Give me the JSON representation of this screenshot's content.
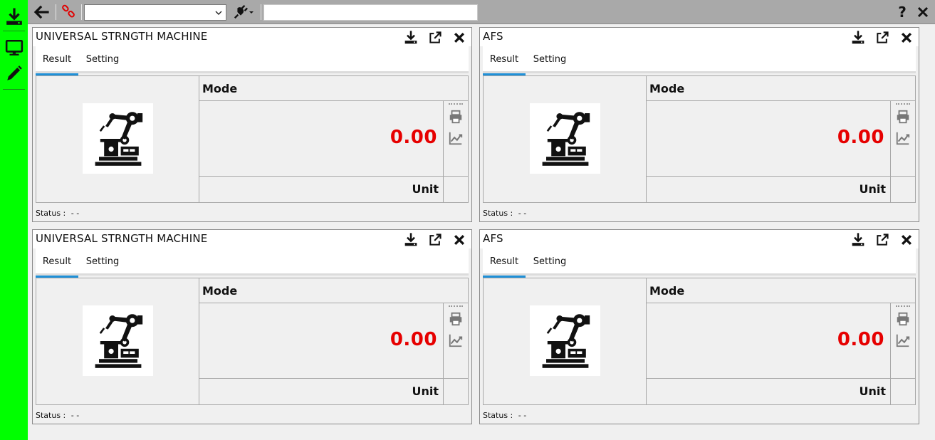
{
  "toolbar": {
    "select_value": "",
    "input_value": "",
    "help_label": "?"
  },
  "panels": [
    {
      "title": "UNIVERSAL STRNGTH MACHINE",
      "tabs": [
        "Result",
        "Setting"
      ],
      "mode_label": "Mode",
      "value": "0.00",
      "unit": "Unit",
      "status_label": "Status :",
      "status_value": "- -"
    },
    {
      "title": "AFS",
      "tabs": [
        "Result",
        "Setting"
      ],
      "mode_label": "Mode",
      "value": "0.00",
      "unit": "Unit",
      "status_label": "Status :",
      "status_value": "- -"
    },
    {
      "title": "UNIVERSAL STRNGTH MACHINE",
      "tabs": [
        "Result",
        "Setting"
      ],
      "mode_label": "Mode",
      "value": "0.00",
      "unit": "Unit",
      "status_label": "Status :",
      "status_value": "- -"
    },
    {
      "title": "AFS",
      "tabs": [
        "Result",
        "Setting"
      ],
      "mode_label": "Mode",
      "value": "0.00",
      "unit": "Unit",
      "status_label": "Status :",
      "status_value": "- -"
    }
  ],
  "colors": {
    "sidebar": "#00ff00",
    "toolbar": "#a9a9a9",
    "value": "#e60000",
    "tab_active": "#1e90d8",
    "link_icon": "#e00000"
  },
  "icons": {
    "sidebar": [
      "download-icon",
      "monitor-icon",
      "pencil-icon"
    ],
    "toolbar": [
      "back-arrow-icon",
      "link-icon",
      "plug-icon",
      "help-icon",
      "close-icon"
    ],
    "panel_header": [
      "download-icon",
      "external-link-icon",
      "close-icon"
    ],
    "panel_side": [
      "printer-icon",
      "chart-icon"
    ],
    "panel_image": "robot-arm-icon"
  }
}
